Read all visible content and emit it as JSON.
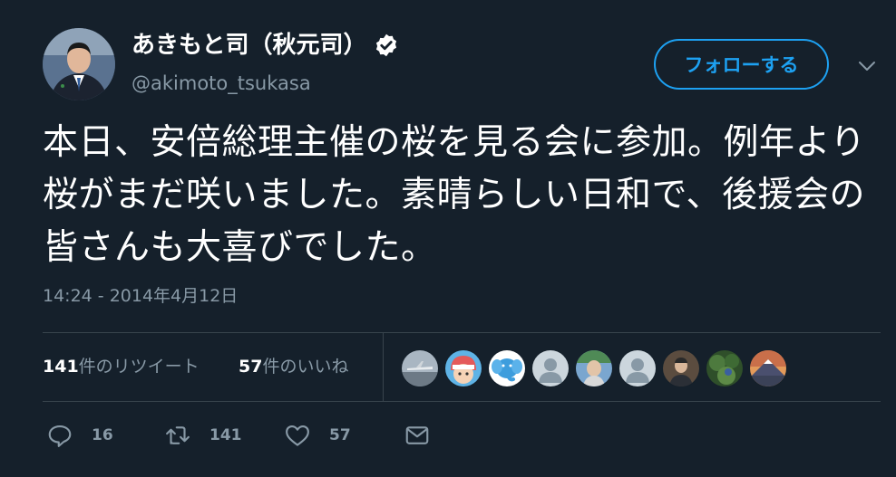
{
  "author": {
    "display_name": "あきもと司（秋元司）",
    "handle": "@akimoto_tsukasa",
    "verified": true,
    "avatar_icon": "person-suit-avatar"
  },
  "follow_button": {
    "label": "フォローする"
  },
  "tweet": {
    "text": "本日、安倍総理主催の桜を見る会に参加。例年より桜がまだ咲いました。素晴らしい日和で、後援会の皆さんも大喜びでした。",
    "timestamp": "14:24 - 2014年4月12日"
  },
  "stats": {
    "retweets_count": "141",
    "retweets_label": "件のリツイート",
    "likes_count": "57",
    "likes_label": "件のいいね"
  },
  "likers": [
    {
      "icon": "airplane-photo-avatar",
      "color": "#9aa7b3"
    },
    {
      "icon": "anime-character-avatar",
      "color": "#e36f6f"
    },
    {
      "icon": "blue-elephant-avatar",
      "color": "#4aa6e0"
    },
    {
      "icon": "default-user-avatar",
      "color": "#8899a6"
    },
    {
      "icon": "person-photo-avatar",
      "color": "#6f9fcf"
    },
    {
      "icon": "default-user-avatar",
      "color": "#8899a6"
    },
    {
      "icon": "person-portrait-avatar",
      "color": "#6b5a4a"
    },
    {
      "icon": "nature-photo-avatar",
      "color": "#3f6b3a"
    },
    {
      "icon": "mountain-photo-avatar",
      "color": "#d9874a"
    }
  ],
  "actions": {
    "reply_count": "16",
    "retweet_count": "141",
    "like_count": "57"
  },
  "colors": {
    "background": "#15202b",
    "accent": "#1da1f2",
    "secondary_text": "#8899a6",
    "divider": "#38444d"
  }
}
